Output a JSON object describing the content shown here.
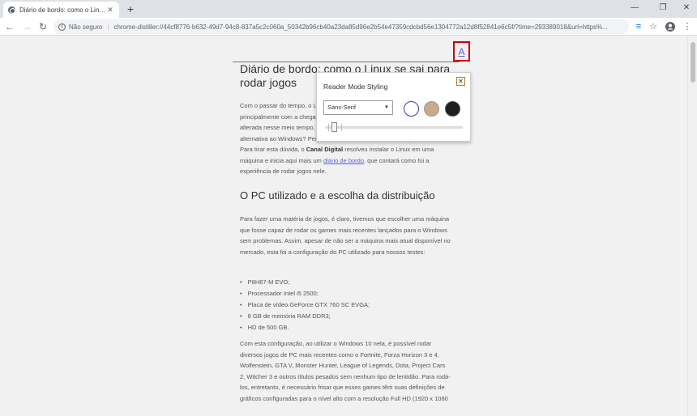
{
  "browser": {
    "tab_title": "Diário de bordo: como o Linux se",
    "tab_close": "✕",
    "new_tab": "+",
    "win_minimize": "—",
    "win_restore": "❐",
    "win_close": "✕",
    "security_label": "Não seguro",
    "separator": "|",
    "url": "chrome-distiller://44cf8776-b632-49d7-94c8-837a5c2c060a_50342b96cb40a23da85d96e2b54e47359cdcbd56e1304772a12d8f52841e6c5f/?time=293389018&url=https%..."
  },
  "article": {
    "title": "Diário de bordo: como o Linux se sai para rodar jogos",
    "p1_parts": {
      "a": "Com o passar do tempo, o Linux vem conquistando espaço nos games, principalmente com a chegada do Steam para o sistema. Muita coisa foi alterada nesse meio tempo, mas será que o Linux é realmente uma alternativa ao Windows? Pensando na eficiência, facilidade e qualidade. Para tirar esta dúvida, o ",
      "bold": "Canal Digital",
      "b": " resolveu instalar o Linux em uma máquina e inicia aqui mais um ",
      "link": "diário de bordo",
      "c": ", que contará como foi a experiência de rodar jogos nele."
    },
    "h2": "O PC utilizado e a escolha da distribuição",
    "p2": "Para fazer uma matéria de jogos, é claro, tivemos que escolher uma máquina que fosse capaz de rodar os games mais recentes lançados para o Windows sem problemas. Assim, apesar de não ser a máquina mais atual disponível no mercado, esta foi a configuração do PC utilizado para nossos testes:",
    "specs": [
      "P8H67-M EVO;",
      "Processador Intel i5 2500;",
      "Placa de vídeo GeForce GTX 760 SC EVGA;",
      "8 GB de memória RAM DDR3;",
      "HD de 500 GB."
    ],
    "p3": "Com esta configuração, ao utilizar o Windows 10 nela, é possível rodar diversos jogos de PC mais recentes como o Fortnite, Forza Horizon 3 e 4, Wolfenstein, GTA V, Monster Hunter, League of Legends, Dota, Project Cars 2, Witcher 3 e outros títulos pesados sem nenhum tipo de lentidão. Para rodá-los, entretanto, é necessário frisar que esses games têm suas definições de gráficos configuradas para o nível alto com a resolução Full HD (1920 x 1080"
  },
  "style_button": "A",
  "popup": {
    "title": "Reader Mode Styling",
    "close": "✕",
    "font_selected": "Sans-Serif",
    "themes": [
      "light",
      "sepia",
      "dark"
    ],
    "selected_theme": "light",
    "font_size_level": 0.05
  }
}
